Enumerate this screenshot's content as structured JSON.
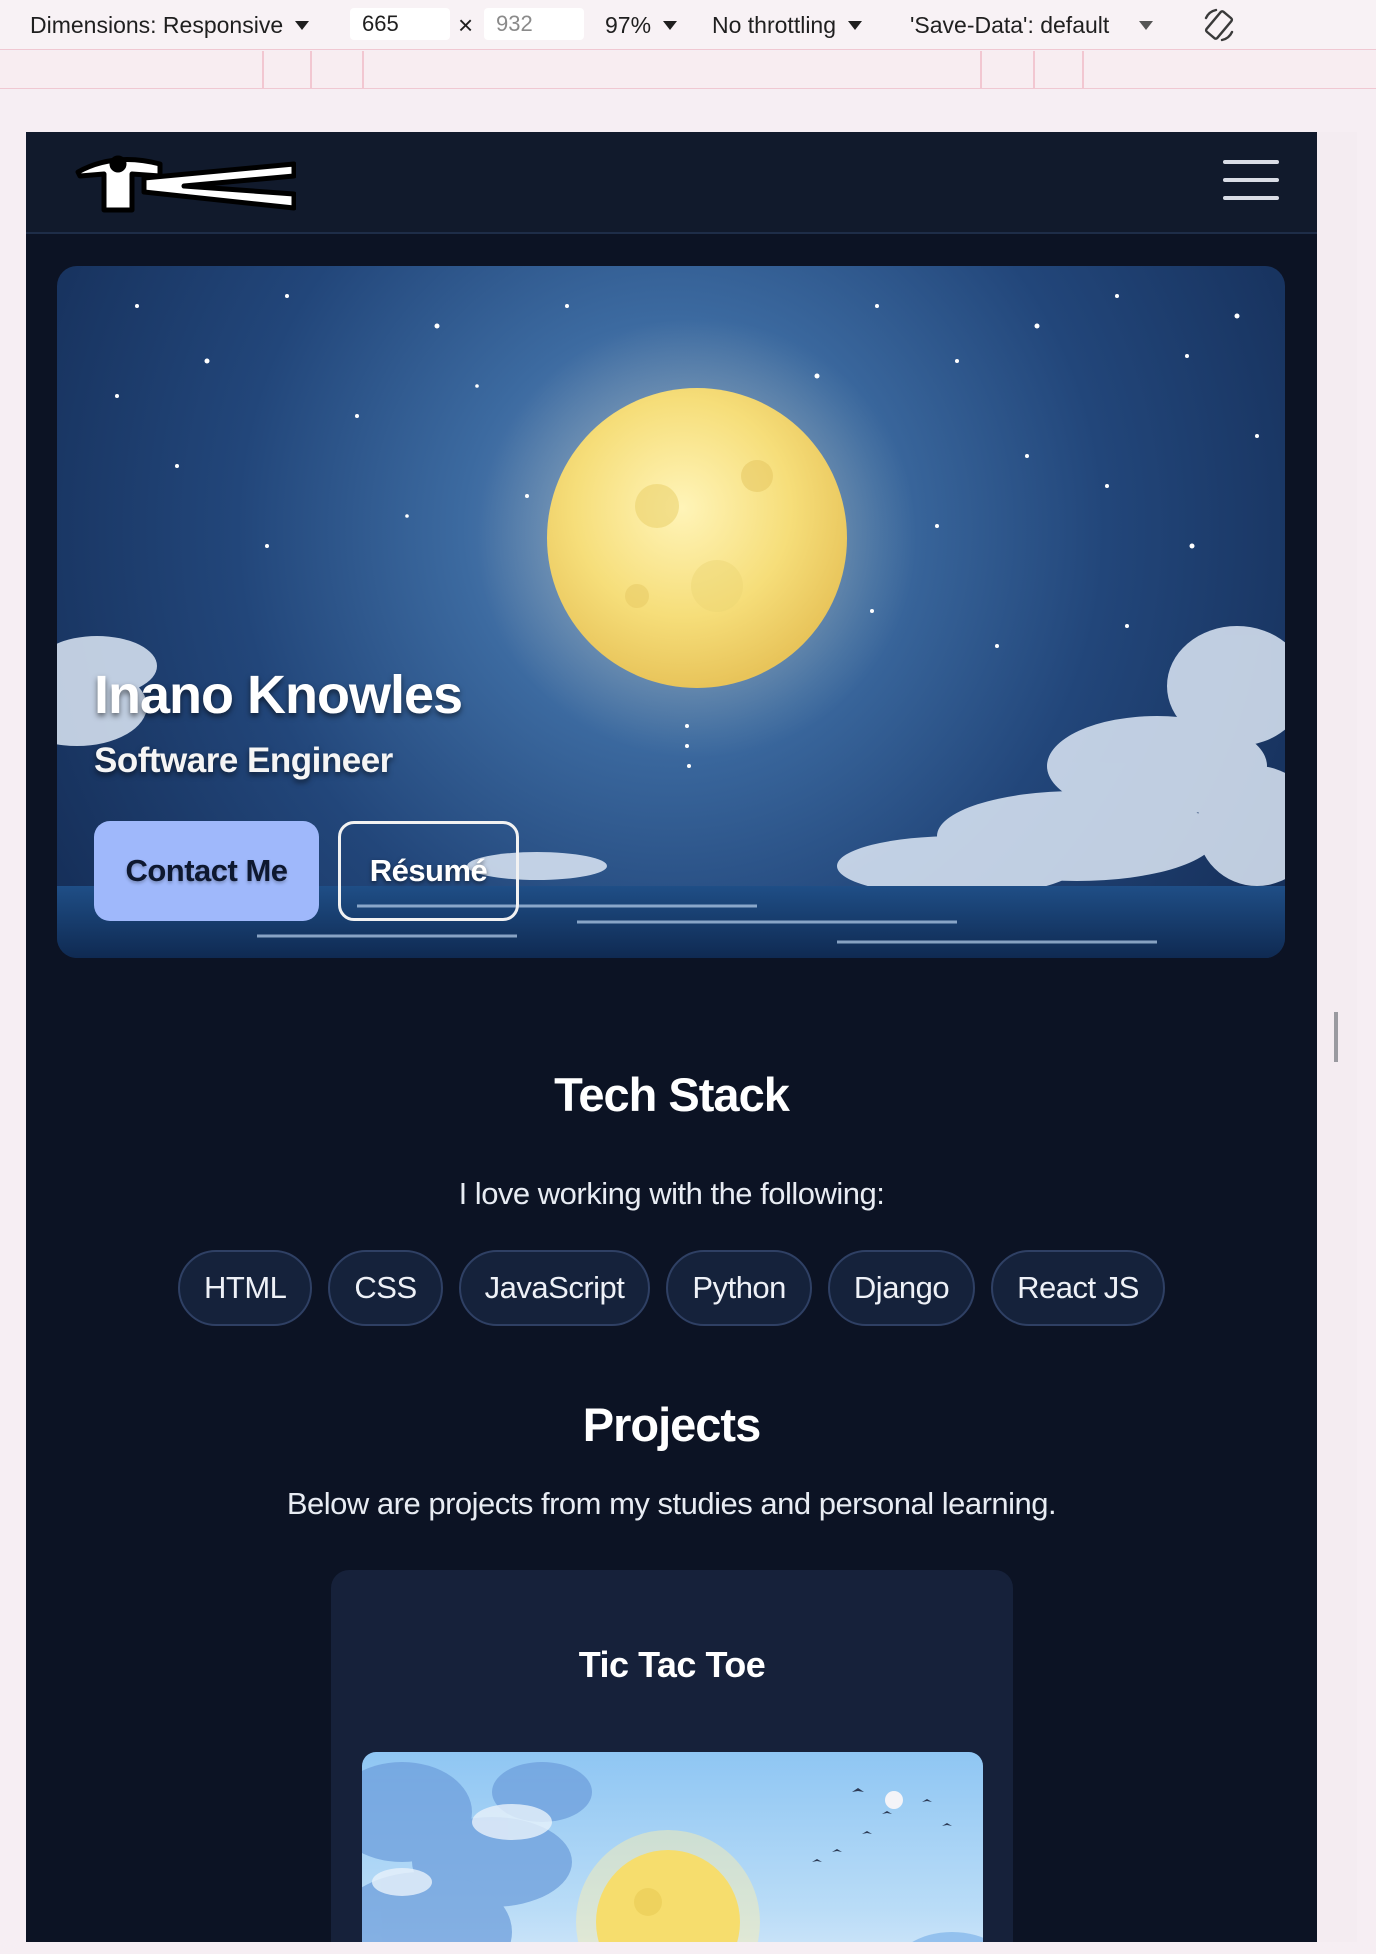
{
  "devtools": {
    "dimensions_label": "Dimensions: Responsive",
    "width_value": "665",
    "height_placeholder": "932",
    "times_symbol": "×",
    "zoom": "97%",
    "throttling": "No throttling",
    "save_data": "'Save-Data': default"
  },
  "hero": {
    "name": "Inano Knowles",
    "role": "Software Engineer",
    "contact_label": "Contact Me",
    "resume_label": "Résumé"
  },
  "tech_stack": {
    "title": "Tech Stack",
    "intro": "I love working with the following:",
    "items": [
      "HTML",
      "CSS",
      "JavaScript",
      "Python",
      "Django",
      "React JS"
    ]
  },
  "projects": {
    "title": "Projects",
    "intro": "Below are projects from my studies and personal learning.",
    "cards": [
      {
        "title": "Tic Tac Toe"
      }
    ]
  },
  "colors": {
    "page_bg": "#0c1324",
    "header_bg": "#111a2c",
    "accent_button": "#9fb8fb",
    "chip_border": "#2f4064",
    "card_bg": "#16213a"
  }
}
